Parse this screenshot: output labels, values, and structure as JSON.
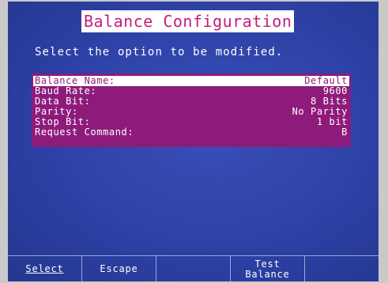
{
  "title": "Balance Configuration",
  "prompt": "Select the option to be modified.",
  "rows": [
    {
      "label": "Balance Name:",
      "value": "Default"
    },
    {
      "label": "Baud Rate:",
      "value": "9600"
    },
    {
      "label": "Data Bit:",
      "value": "8 Bits"
    },
    {
      "label": "Parity:",
      "value": "No Parity"
    },
    {
      "label": "Stop Bit:",
      "value": "1 bit"
    },
    {
      "label": "Request Command:",
      "value": "B"
    }
  ],
  "softkeys": {
    "select": "Select",
    "escape": "Escape",
    "key3": "",
    "test_balance": "Test\nBalance",
    "key5": ""
  },
  "colors": {
    "screen": "#2c3fa0",
    "panel": "#8e1b7c",
    "title_text": "#c31d7c"
  }
}
